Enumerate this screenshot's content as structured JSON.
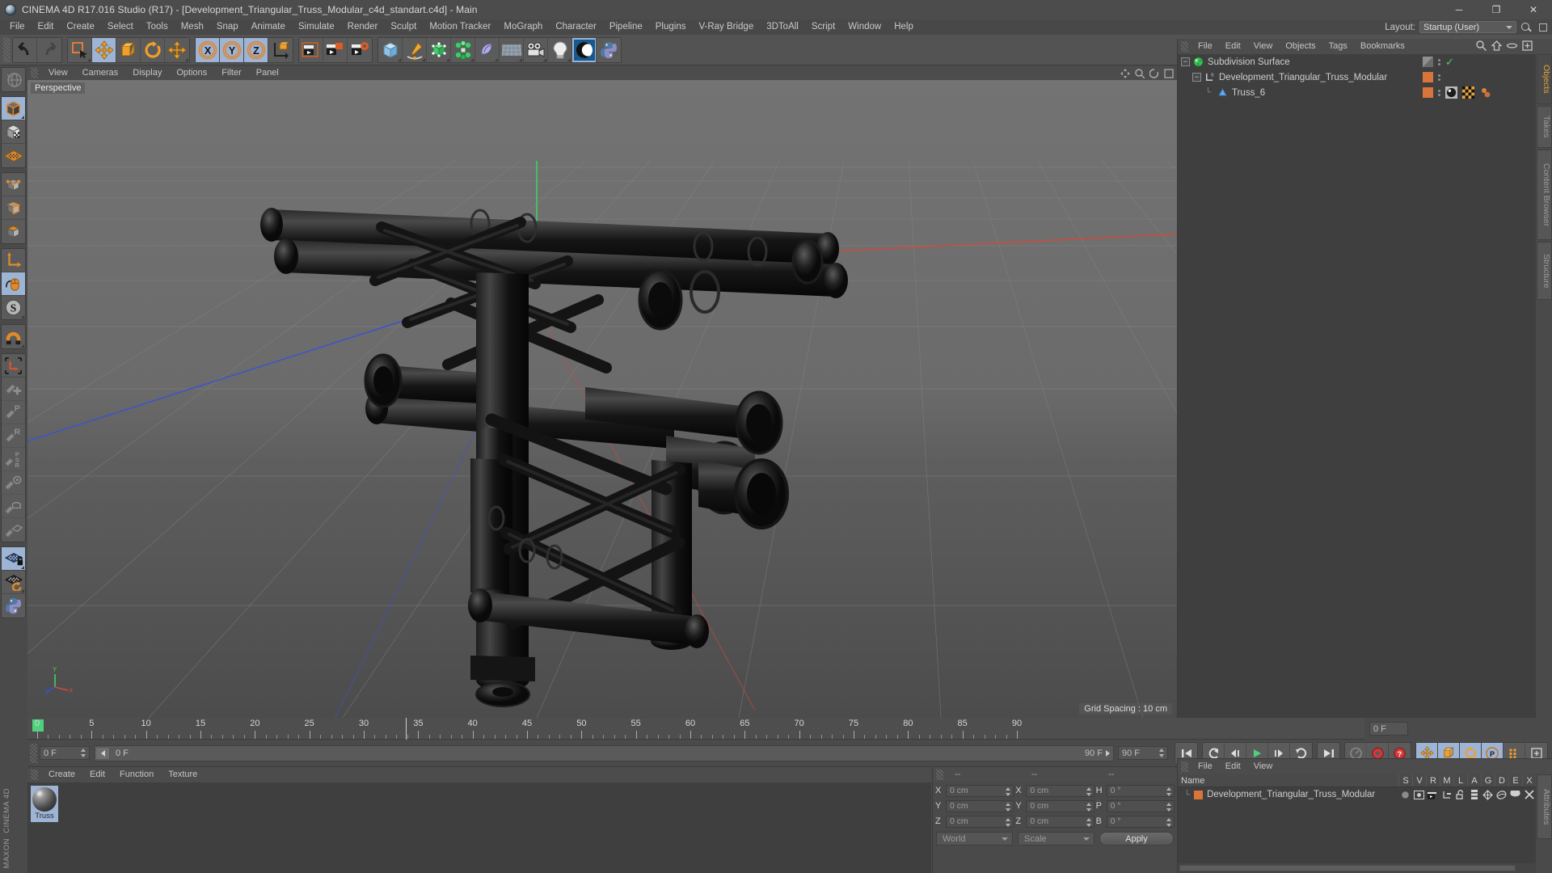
{
  "window": {
    "title": "CINEMA 4D R17.016 Studio (R17) - [Development_Triangular_Truss_Modular_c4d_standart.c4d] - Main",
    "minimize": "─",
    "maximize": "❐",
    "close": "✕"
  },
  "menubar": {
    "items": [
      "File",
      "Edit",
      "Create",
      "Select",
      "Tools",
      "Mesh",
      "Snap",
      "Animate",
      "Simulate",
      "Render",
      "Sculpt",
      "Motion Tracker",
      "MoGraph",
      "Character",
      "Pipeline",
      "Plugins",
      "V-Ray Bridge",
      "3DToAll",
      "Script",
      "Window",
      "Help"
    ],
    "layout_label": "Layout:",
    "layout_value": "Startup (User)"
  },
  "toolbar": {
    "groups": [
      {
        "name": "undo-redo",
        "buttons": [
          {
            "name": "undo-button",
            "icon": "undo-icon",
            "state": "normal"
          },
          {
            "name": "redo-button",
            "icon": "redo-icon",
            "state": "dim"
          }
        ]
      },
      {
        "name": "transform-tools",
        "buttons": [
          {
            "name": "live-selection-button",
            "icon": "live-selection-icon",
            "state": "normal"
          },
          {
            "name": "move-button",
            "icon": "move-icon",
            "state": "active"
          },
          {
            "name": "scale-button",
            "icon": "scale-icon",
            "state": "normal"
          },
          {
            "name": "rotate-button",
            "icon": "rotate-icon",
            "state": "normal"
          },
          {
            "name": "move-extra-button",
            "icon": "move-axis-icon",
            "state": "normal"
          }
        ]
      },
      {
        "name": "axis-locks",
        "buttons": [
          {
            "name": "lock-x-button",
            "icon": "axis-x-icon",
            "state": "active",
            "label": "X"
          },
          {
            "name": "lock-y-button",
            "icon": "axis-y-icon",
            "state": "active",
            "label": "Y"
          },
          {
            "name": "lock-z-button",
            "icon": "axis-z-icon",
            "state": "active",
            "label": "Z"
          },
          {
            "name": "world-object-axis-button",
            "icon": "world-coordinate-icon",
            "state": "normal"
          }
        ]
      },
      {
        "name": "render-group",
        "buttons": [
          {
            "name": "render-view-button",
            "icon": "render-view-icon",
            "state": "normal"
          },
          {
            "name": "render-to-picture-viewer-button",
            "icon": "render-picture-viewer-icon",
            "state": "normal"
          },
          {
            "name": "render-settings-button",
            "icon": "render-settings-icon",
            "state": "normal"
          }
        ]
      },
      {
        "name": "create-group",
        "buttons": [
          {
            "name": "add-cube-button",
            "icon": "cube-icon",
            "state": "normal"
          },
          {
            "name": "add-spline-button",
            "icon": "pen-spline-icon",
            "state": "normal"
          },
          {
            "name": "add-generator-button",
            "icon": "nurbs-generator-icon",
            "state": "normal"
          },
          {
            "name": "add-deformer-button",
            "icon": "deformer-icon",
            "state": "normal"
          },
          {
            "name": "add-scene-object-button",
            "icon": "environment-icon",
            "state": "normal"
          },
          {
            "name": "add-floor-button",
            "icon": "floor-grid-icon",
            "state": "normal"
          },
          {
            "name": "add-camera-button",
            "icon": "camera-icon",
            "state": "normal"
          },
          {
            "name": "add-light-button",
            "icon": "light-bulb-icon",
            "state": "normal"
          },
          {
            "name": "content-browser-button",
            "icon": "c4d-swirl-icon",
            "state": "active"
          },
          {
            "name": "python-button",
            "icon": "python-icon",
            "state": "normal"
          }
        ]
      }
    ]
  },
  "left_toolbar": {
    "groups": [
      {
        "name": "selection-modes-top",
        "buttons": [
          {
            "name": "viewport-navigation-button",
            "icon": "globe-navigation-icon",
            "state": "dim"
          }
        ]
      },
      {
        "name": "editable-modes",
        "buttons": [
          {
            "name": "make-editable-button",
            "icon": "make-editable-cube-icon",
            "state": "active"
          },
          {
            "name": "texture-mode-button",
            "icon": "texture-checker-cube-icon",
            "state": "normal"
          },
          {
            "name": "viewport-solo-button",
            "icon": "grid-plane-icon",
            "state": "normal"
          }
        ]
      },
      {
        "name": "component-modes",
        "buttons": [
          {
            "name": "points-mode-button",
            "icon": "points-cube-icon",
            "state": "normal"
          },
          {
            "name": "edges-mode-button",
            "icon": "edges-cube-icon",
            "state": "normal"
          },
          {
            "name": "polygons-mode-button",
            "icon": "polygons-cube-icon",
            "state": "normal"
          }
        ]
      },
      {
        "name": "axis-modes",
        "buttons": [
          {
            "name": "object-axis-button",
            "icon": "axis-arrow-icon",
            "state": "normal"
          },
          {
            "name": "enable-axis-button",
            "icon": "mouse-axis-icon",
            "state": "active"
          },
          {
            "name": "soft-selection-button",
            "icon": "soft-selection-s-icon",
            "state": "normal"
          }
        ]
      },
      {
        "name": "snap-group",
        "buttons": [
          {
            "name": "snap-button",
            "icon": "magnet-snap-icon",
            "state": "normal"
          }
        ]
      },
      {
        "name": "workplane-group",
        "buttons": [
          {
            "name": "workplane-button",
            "icon": "workplane-axis-icon",
            "state": "normal"
          },
          {
            "name": "add-point-button",
            "icon": "add-point-icon",
            "state": "dim"
          },
          {
            "name": "position-tool-button",
            "icon": "position-p-icon",
            "state": "dim"
          },
          {
            "name": "rotation-tool-button",
            "icon": "rotation-r-icon",
            "state": "dim"
          },
          {
            "name": "psr-tool-button",
            "icon": "psr-icon",
            "state": "dim"
          },
          {
            "name": "point-target-button",
            "icon": "point-target-icon",
            "state": "dim"
          },
          {
            "name": "arc-tool-button",
            "icon": "arc-tool-icon",
            "state": "dim"
          },
          {
            "name": "plane-tool-button",
            "icon": "plane-tool-icon",
            "state": "dim"
          }
        ]
      },
      {
        "name": "grid-group",
        "buttons": [
          {
            "name": "lock-workplane-button",
            "icon": "workplane-lock-icon",
            "state": "active"
          },
          {
            "name": "workplane-rotate-button",
            "icon": "workplane-rotate-icon",
            "state": "normal"
          },
          {
            "name": "python-script-button",
            "icon": "python-icon",
            "state": "normal"
          }
        ]
      }
    ],
    "brand_lines": [
      "MAXON",
      "CINEMA 4D"
    ]
  },
  "viewport": {
    "menu": [
      "View",
      "Cameras",
      "Display",
      "Options",
      "Filter",
      "Panel"
    ],
    "label": "Perspective",
    "grid_spacing": "Grid Spacing : 10 cm",
    "axis_labels": {
      "x": "X",
      "y": "Y",
      "z": "Z"
    },
    "corner_icons": [
      "pan-view-icon",
      "zoom-view-icon",
      "rotate-view-icon",
      "maximize-view-icon"
    ]
  },
  "timeline": {
    "start_label": "0",
    "ticks": [
      "0",
      "5",
      "10",
      "15",
      "20",
      "25",
      "30",
      "35",
      "40",
      "45",
      "50",
      "55",
      "60",
      "65",
      "70",
      "75",
      "80",
      "85",
      "90"
    ],
    "tick_values": [
      0,
      5,
      10,
      15,
      20,
      25,
      30,
      35,
      40,
      45,
      50,
      55,
      60,
      65,
      70,
      75,
      80,
      85,
      90
    ],
    "current_frame_field": "0 F",
    "current_frame_right": "0 F",
    "time_slider_left": "0 F",
    "time_slider_right": "90 F",
    "end_frame_field": "90 F",
    "transport": [
      {
        "name": "go-to-start-button",
        "icon": "skip-start-icon"
      },
      {
        "name": "previous-key-button",
        "icon": "prev-key-icon"
      },
      {
        "name": "play-backwards-button",
        "icon": "play-back-icon"
      },
      {
        "name": "play-forwards-button",
        "icon": "play-icon"
      },
      {
        "name": "next-key-button",
        "icon": "next-key-icon"
      },
      {
        "name": "loop-button",
        "icon": "loop-icon"
      },
      {
        "name": "go-to-end-button",
        "icon": "skip-end-icon"
      }
    ],
    "record_group": [
      {
        "name": "record-active-objects-button",
        "icon": "autokey-gauge-icon",
        "state": "dim"
      },
      {
        "name": "record-button",
        "icon": "record-circle-icon",
        "state": "normal"
      },
      {
        "name": "autokeying-button",
        "icon": "autokey-question-icon",
        "state": "normal"
      }
    ],
    "key_group": [
      {
        "name": "position-key-button",
        "icon": "position-key-icon"
      },
      {
        "name": "scale-key-button",
        "icon": "scale-key-icon"
      },
      {
        "name": "rotation-key-button",
        "icon": "rotation-key-icon"
      },
      {
        "name": "parameter-key-button",
        "icon": "parameter-p-key-icon"
      },
      {
        "name": "point-level-animation-button",
        "icon": "pla-dots-icon"
      },
      {
        "name": "keyframe-options-button",
        "icon": "keyframe-options-icon"
      }
    ]
  },
  "material_manager": {
    "menu": [
      "Create",
      "Edit",
      "Function",
      "Texture"
    ],
    "materials": [
      {
        "name": "Truss",
        "selected": true
      }
    ]
  },
  "coordinates": {
    "header": [
      "--",
      "--",
      "--"
    ],
    "rows": [
      {
        "label_pos": "X",
        "pos": "0 cm",
        "label_size": "X",
        "size": "0 cm",
        "label_rot": "H",
        "rot": "0 °"
      },
      {
        "label_pos": "Y",
        "pos": "0 cm",
        "label_size": "Y",
        "size": "0 cm",
        "label_rot": "P",
        "rot": "0 °"
      },
      {
        "label_pos": "Z",
        "pos": "0 cm",
        "label_size": "Z",
        "size": "0 cm",
        "label_rot": "B",
        "rot": "0 °"
      }
    ],
    "coordinate_system": "World",
    "transform_mode": "Scale",
    "apply_label": "Apply"
  },
  "object_manager": {
    "menu": [
      "File",
      "Edit",
      "View",
      "Objects",
      "Tags",
      "Bookmarks"
    ],
    "icons": [
      "search-icon",
      "home-icon",
      "ellipse-icon",
      "add-layer-icon"
    ],
    "rows": [
      {
        "name": "Subdivision Surface",
        "depth": 0,
        "icon": "subdivision-surface-icon",
        "icon_color": "#3fbf55",
        "tag_color": "#8f8f8f",
        "has_check": true,
        "tags": []
      },
      {
        "name": "Development_Triangular_Truss_Modular",
        "depth": 1,
        "icon": "null-object-icon",
        "icon_color": "#d9d9d9",
        "tag_color": "#d9743a",
        "has_check": false,
        "tags": []
      },
      {
        "name": "Truss_6",
        "depth": 2,
        "icon": "polygon-object-icon",
        "icon_color": "#6aa9e8",
        "tag_color": "#d9743a",
        "has_check": false,
        "tags": [
          "material-tag-icon",
          "uvw-tag-icon",
          "selection-tag-icon"
        ]
      }
    ],
    "vertical_tabs": [
      "Objects",
      "Takes",
      "Content Browser",
      "Structure"
    ]
  },
  "attribute_manager": {
    "menu": [
      "File",
      "Edit",
      "View"
    ],
    "columns": [
      "Name",
      "S",
      "V",
      "R",
      "M",
      "L",
      "A",
      "G",
      "D",
      "E",
      "X"
    ],
    "rows": [
      {
        "name": "Development_Triangular_Truss_Modular",
        "color": "#d9743a",
        "cells": [
          "visibility-dot-icon",
          "editor-visibility-icon",
          "render-visibility-icon",
          "hierarchy-icon",
          "unlock-icon",
          "layer-list-icon",
          "generator-icon",
          "deformer-icon",
          "cap-icon",
          "x-icon"
        ]
      }
    ],
    "vertical_tabs": [
      "Attributes"
    ]
  },
  "colors": {
    "accent_orange": "#e39a3c",
    "selection_blue": "#9db4d4",
    "panel_bg": "#4a4a4a",
    "list_bg": "#3f3f3f",
    "axis_x": "#c0392b",
    "axis_y": "#2ecc40",
    "axis_z": "#3b5fd0",
    "green_marker": "#4fd07a"
  }
}
